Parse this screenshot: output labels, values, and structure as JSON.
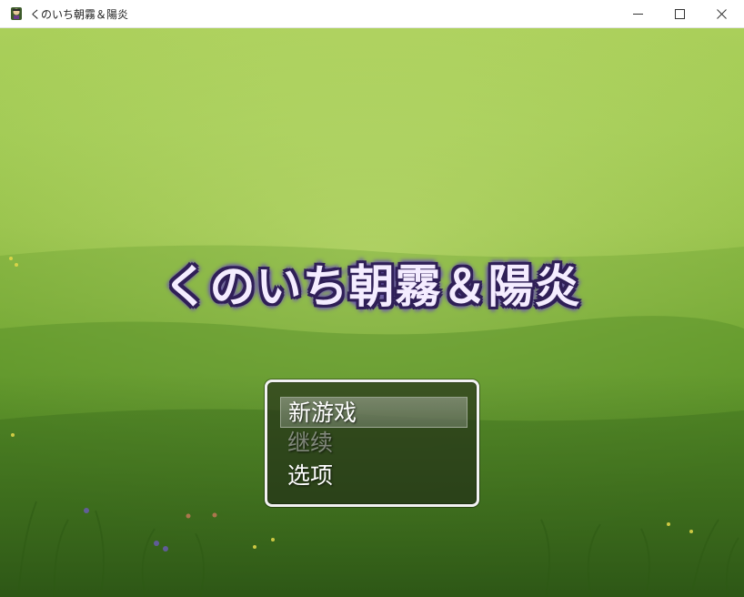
{
  "window": {
    "title": "くのいち朝霧＆陽炎",
    "icon": "game-app-icon",
    "controls": [
      "minimize-icon",
      "maximize-icon",
      "close-icon"
    ]
  },
  "game": {
    "title": "くのいち朝霧＆陽炎",
    "menu": {
      "items": [
        {
          "label": "新游戏",
          "selected": true,
          "enabled": true
        },
        {
          "label": "继续",
          "selected": false,
          "enabled": false
        },
        {
          "label": "选项",
          "selected": false,
          "enabled": true
        }
      ]
    }
  },
  "colors": {
    "title_fill": "#f4ecff",
    "title_outline": "#2f1f57",
    "menu_border": "#f2f2f2",
    "grass_light": "#aacf5a",
    "grass_dark": "#3d6c1d"
  }
}
